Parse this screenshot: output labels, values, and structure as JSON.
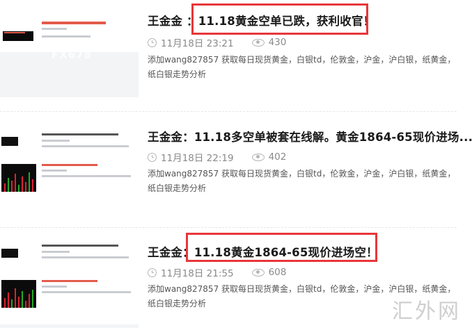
{
  "articles": [
    {
      "title_prefix": "王金金  ：",
      "title_rest": "11.18黄金空单已跌，获利收官！",
      "date": "11月18日 23:21",
      "views": "430",
      "desc": "添加wang827857 获取每日现货黄金，白银td，伦敦金，沪金，沪白银，纸黄金，纸白银走势分析",
      "thumb_watermark": "FX678"
    },
    {
      "title_prefix": "王金金：",
      "title_rest": "11.18多空单被套在线解。黄金1864-65现价进场...",
      "date": "11月18日 22:19",
      "views": "402",
      "desc": "添加wang827857 获取每日现货黄金，白银td，伦敦金，沪金，沪白银，纸黄金，纸白银走势分析"
    },
    {
      "title_prefix": "王金金：",
      "title_rest": "11.18黄金1864-65现价进场空！",
      "date": "11月18日 21:55",
      "views": "608",
      "desc": "添加wang827857 获取每日现货黄金，白银td，伦敦金，沪金，沪白银，纸黄金，纸白银走势分析"
    }
  ],
  "site_watermark": "汇外网",
  "colors": {
    "highlight": "#e8363a",
    "title": "#1a1a1a",
    "meta": "#8a8a8a"
  }
}
